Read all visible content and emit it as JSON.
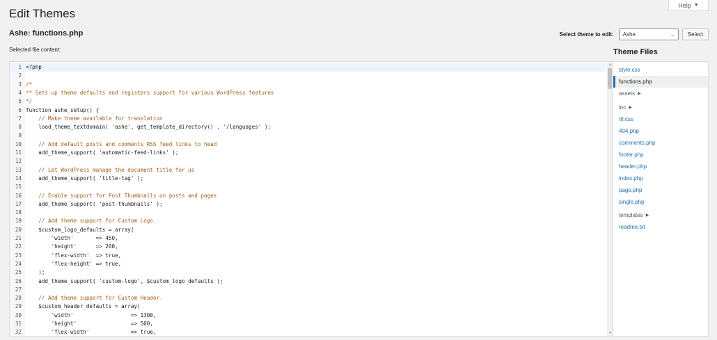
{
  "help": {
    "label": "Help",
    "caret": "▼"
  },
  "page_title": "Edit Themes",
  "file_title": "Ashe: functions.php",
  "selected_label": "Selected file content:",
  "theme_select": {
    "label": "Select theme to edit:",
    "value": "Ashe",
    "button": "Select"
  },
  "files": {
    "heading": "Theme Files",
    "items": [
      {
        "label": "style.css",
        "kind": "file"
      },
      {
        "label": "functions.php",
        "kind": "current"
      },
      {
        "label": "assets",
        "kind": "folder"
      },
      {
        "label": "inc",
        "kind": "folder"
      },
      {
        "label": "rtl.css",
        "kind": "file"
      },
      {
        "label": "404.php",
        "kind": "file"
      },
      {
        "label": "comments.php",
        "kind": "file"
      },
      {
        "label": "footer.php",
        "kind": "file"
      },
      {
        "label": "header.php",
        "kind": "file"
      },
      {
        "label": "index.php",
        "kind": "file"
      },
      {
        "label": "page.php",
        "kind": "file"
      },
      {
        "label": "single.php",
        "kind": "file"
      },
      {
        "label": "templates",
        "kind": "folder"
      },
      {
        "label": "readme.txt",
        "kind": "file"
      }
    ]
  },
  "code_lines": [
    {
      "n": "1",
      "text": "<?php",
      "kind": "code"
    },
    {
      "n": "2",
      "text": "",
      "kind": "code"
    },
    {
      "n": "3",
      "text": "/*",
      "kind": "comment"
    },
    {
      "n": "4",
      "text": "** Sets up theme defaults and registers support for various WordPress features",
      "kind": "comment"
    },
    {
      "n": "5",
      "text": "*/",
      "kind": "comment"
    },
    {
      "n": "6",
      "text": "function ashe_setup() {",
      "kind": "code"
    },
    {
      "n": "7",
      "text": "    // Make theme available for translation",
      "kind": "comment"
    },
    {
      "n": "8",
      "text": "    load_theme_textdomain( 'ashe', get_template_directory() . '/languages' );",
      "kind": "code"
    },
    {
      "n": "9",
      "text": "",
      "kind": "code"
    },
    {
      "n": "10",
      "text": "    // Add default posts and comments RSS feed links to head",
      "kind": "comment"
    },
    {
      "n": "11",
      "text": "    add_theme_support( 'automatic-feed-links' );",
      "kind": "code"
    },
    {
      "n": "12",
      "text": "",
      "kind": "code"
    },
    {
      "n": "13",
      "text": "    // Let WordPress manage the document title for us",
      "kind": "comment"
    },
    {
      "n": "14",
      "text": "    add_theme_support( 'title-tag' );",
      "kind": "code"
    },
    {
      "n": "15",
      "text": "",
      "kind": "code"
    },
    {
      "n": "16",
      "text": "    // Enable support for Post Thumbnails on posts and pages",
      "kind": "comment"
    },
    {
      "n": "17",
      "text": "    add_theme_support( 'post-thumbnails' );",
      "kind": "code"
    },
    {
      "n": "18",
      "text": "",
      "kind": "code"
    },
    {
      "n": "19",
      "text": "    // Add theme support for Custom Logo.",
      "kind": "comment"
    },
    {
      "n": "20",
      "text": "    $custom_logo_defaults = array(",
      "kind": "code"
    },
    {
      "n": "21",
      "text": "        'width'       => 450,",
      "kind": "code"
    },
    {
      "n": "22",
      "text": "        'height'      => 200,",
      "kind": "code"
    },
    {
      "n": "23",
      "text": "        'flex-width'  => true,",
      "kind": "code"
    },
    {
      "n": "24",
      "text": "        'flex-height' => true,",
      "kind": "code"
    },
    {
      "n": "25",
      "text": "    );",
      "kind": "code"
    },
    {
      "n": "26",
      "text": "    add_theme_support( 'custom-logo', $custom_logo_defaults );",
      "kind": "code"
    },
    {
      "n": "27",
      "text": "",
      "kind": "code"
    },
    {
      "n": "28",
      "text": "    // Add theme support for Custom Header.",
      "kind": "comment"
    },
    {
      "n": "29",
      "text": "    $custom_header_defaults = array(",
      "kind": "code"
    },
    {
      "n": "30",
      "text": "        'width'                  => 1300,",
      "kind": "code"
    },
    {
      "n": "31",
      "text": "        'height'                 => 500,",
      "kind": "code"
    },
    {
      "n": "32",
      "text": "        'flex-width'             => true,",
      "kind": "code"
    }
  ],
  "colors": {
    "link": "#2271b1",
    "comment": "#a15d19",
    "text": "#1d2327",
    "background": "#f1f1f1"
  }
}
